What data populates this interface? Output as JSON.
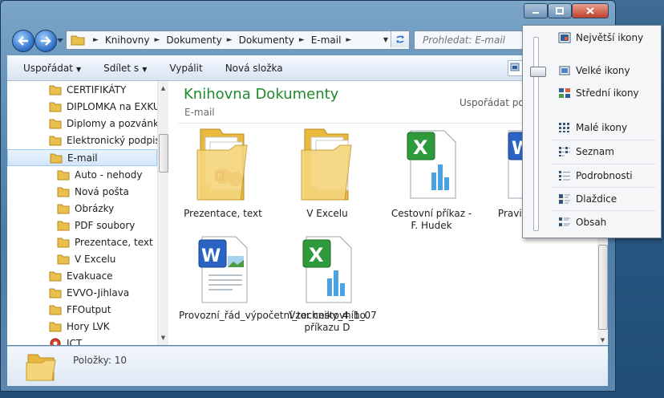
{
  "window": {
    "controls": [
      "minimize",
      "maximize",
      "close"
    ]
  },
  "nav": {
    "breadcrumbs": [
      "Knihovny",
      "Dokumenty",
      "Dokumenty",
      "E-mail"
    ],
    "search_placeholder": "Prohledat: E-mail"
  },
  "toolbar": {
    "organize": "Uspořádat",
    "share": "Sdílet s",
    "burn": "Vypálit",
    "new_folder": "Nová složka"
  },
  "sidebar": {
    "items": [
      {
        "label": "CERTIFIKÁTY",
        "icon": "folder-icon"
      },
      {
        "label": "DIPLOMKA na EXKURZE",
        "icon": "folder-icon"
      },
      {
        "label": "Diplomy a pozvánky",
        "icon": "folder-icon"
      },
      {
        "label": "Elektronický podpis",
        "icon": "folder-icon"
      },
      {
        "label": "E-mail",
        "icon": "folder-icon",
        "selected": true
      },
      {
        "label": "Auto - nehody",
        "icon": "folder-icon"
      },
      {
        "label": "Nová pošta",
        "icon": "folder-icon"
      },
      {
        "label": "Obrázky",
        "icon": "folder-icon"
      },
      {
        "label": "PDF soubory",
        "icon": "folder-icon"
      },
      {
        "label": "Prezentace, text",
        "icon": "folder-icon"
      },
      {
        "label": "V Excelu",
        "icon": "folder-icon"
      },
      {
        "label": "Evakuace",
        "icon": "folder-icon"
      },
      {
        "label": "EVVO-Jihlava",
        "icon": "folder-icon"
      },
      {
        "label": "FFOutput",
        "icon": "folder-icon"
      },
      {
        "label": "Hory LVK",
        "icon": "folder-icon"
      },
      {
        "label": "ICT",
        "icon": "ict-icon"
      }
    ]
  },
  "main": {
    "title": "Knihovna Dokumenty",
    "subtitle": "E-mail",
    "arrange_label": "Uspořádat podle:",
    "files": [
      {
        "name": "Prezentace, text",
        "icon": "folder-powerpoint-icon"
      },
      {
        "name": "V Excelu",
        "icon": "folder-icon"
      },
      {
        "name": "Cestovní příkaz - F. Hudek",
        "icon": "excel-file-icon"
      },
      {
        "name": "Pravidla_ele_",
        "icon": "word-file-icon"
      },
      {
        "name": "Provozní_řád_výpočetní_techniky_4_1_07",
        "icon": "word-file-icon"
      },
      {
        "name": "Vzor cestovního příkazu D",
        "icon": "excel-file-icon"
      }
    ]
  },
  "details": {
    "count": "Položky: 10"
  },
  "view_menu": {
    "items": [
      {
        "label": "Největší ikony",
        "icon": "extra-large-icons-icon"
      },
      {
        "label": "Velké ikony",
        "icon": "large-icons-icon"
      },
      {
        "label": "Střední ikony",
        "icon": "medium-icons-icon"
      },
      {
        "label": "Malé ikony",
        "icon": "small-icons-icon"
      },
      {
        "label": "Seznam",
        "icon": "list-icon"
      },
      {
        "label": "Podrobnosti",
        "icon": "details-icon"
      },
      {
        "label": "Dlaždice",
        "icon": "tiles-icon"
      },
      {
        "label": "Obsah",
        "icon": "content-icon"
      }
    ]
  }
}
